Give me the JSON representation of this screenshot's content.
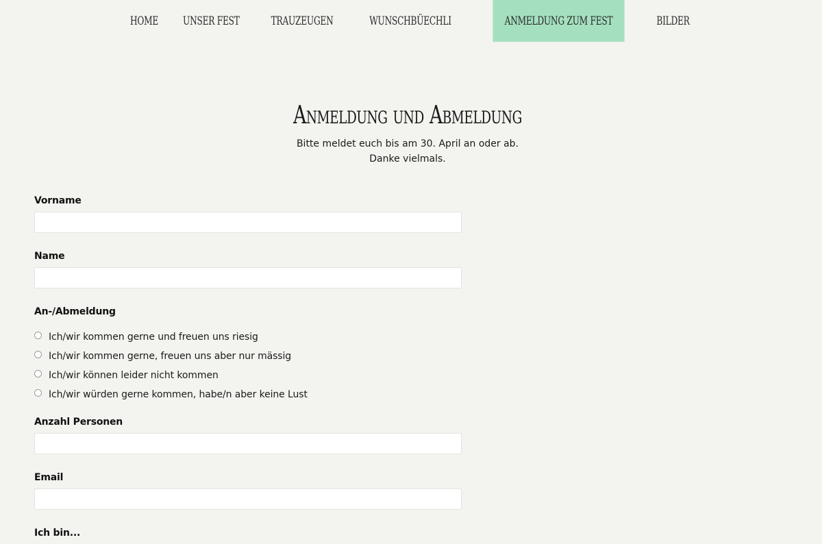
{
  "nav": {
    "items": [
      {
        "label": "Home",
        "active": false
      },
      {
        "label": "Unser Fest",
        "active": false
      },
      {
        "label": "Trauzeugen",
        "active": false
      },
      {
        "label": "Wunschbüechli",
        "active": false
      },
      {
        "label": "Anmeldung zum Fest",
        "active": true
      },
      {
        "label": "Bilder",
        "active": false
      }
    ],
    "active_color": "#a4e0bf"
  },
  "page": {
    "title": "Anmeldung und Abmeldung",
    "intro_line1": "Bitte meldet euch bis am 30. April an oder ab.",
    "intro_line2": "Danke vielmals."
  },
  "form": {
    "vorname": {
      "label": "Vorname",
      "value": "",
      "placeholder": ""
    },
    "name": {
      "label": "Name",
      "value": "",
      "placeholder": ""
    },
    "anmeldung": {
      "label": "An-/Abmeldung",
      "options": [
        {
          "label": "Ich/wir kommen gerne und freuen uns riesig",
          "selected": false
        },
        {
          "label": "Ich/wir kommen gerne, freuen uns aber nur mässig",
          "selected": false
        },
        {
          "label": "Ich/wir können leider nicht kommen",
          "selected": false
        },
        {
          "label": "Ich/wir würden gerne kommen, habe/n aber keine Lust",
          "selected": false
        }
      ]
    },
    "anzahl": {
      "label": "Anzahl Personen",
      "value": "",
      "placeholder": ""
    },
    "email": {
      "label": "Email",
      "value": "",
      "placeholder": ""
    },
    "ich_bin": {
      "label": "Ich bin..."
    }
  },
  "colors": {
    "background": "#f3f3ef",
    "input_background": "#ffffff",
    "nav_active": "#a4e0bf"
  }
}
